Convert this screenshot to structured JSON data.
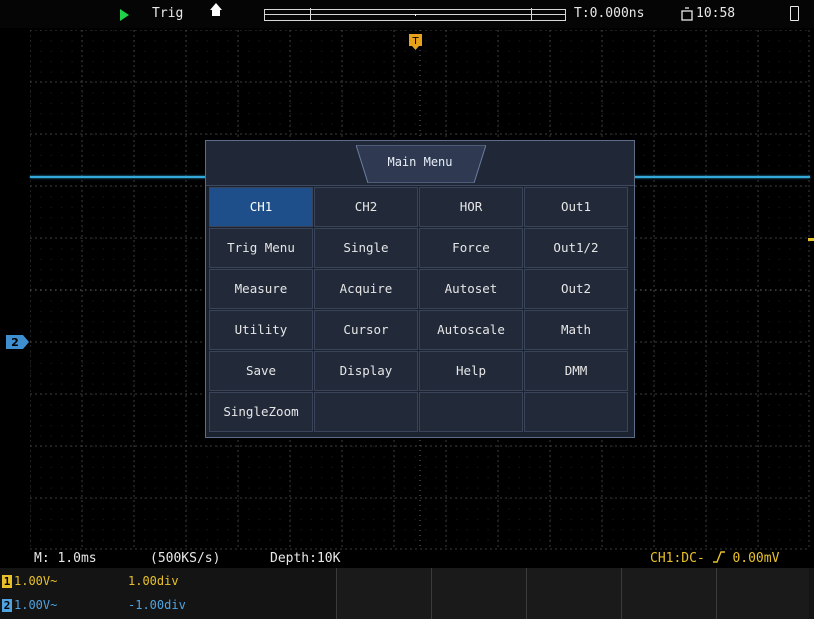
{
  "status_bar": {
    "trigger_state": "Trig",
    "time_offset": "T:0.000ns",
    "clock": "10:58",
    "icons": [
      "run-icon",
      "home-icon",
      "memory-position-bar",
      "timer-icon",
      "battery-icon"
    ]
  },
  "main_menu": {
    "title": "Main Menu",
    "items": [
      [
        "CH1",
        "CH2",
        "HOR",
        "Out1"
      ],
      [
        "Trig Menu",
        "Single",
        "Force",
        "Out1/2"
      ],
      [
        "Measure",
        "Acquire",
        "Autoset",
        "Out2"
      ],
      [
        "Utility",
        "Cursor",
        "Autoscale",
        "Math"
      ],
      [
        "Save",
        "Display",
        "Help",
        "DMM"
      ],
      [
        "SingleZoom",
        "",
        "",
        ""
      ]
    ],
    "selected": "CH1"
  },
  "info_bar": {
    "timebase": "M: 1.0ms",
    "sample_rate": "(500KS/s)",
    "depth": "Depth:10K",
    "trigger": "CH1:DC-",
    "trigger_level": "0.00mV"
  },
  "channels": [
    {
      "badge": "1",
      "scale": "1.00V~",
      "position": "1.00div",
      "color": "#e8c12a"
    },
    {
      "badge": "2",
      "scale": "1.00V~",
      "position": "-1.00div",
      "color": "#4fa3e0"
    }
  ],
  "markers": {
    "ch2_marker": "2",
    "trigger_marker": "T"
  },
  "colors": {
    "ch1": "#34a8d8",
    "ch2": "#4fa3e0",
    "trigger": "#e8c12a",
    "menu_selected": "#1e4f8a"
  }
}
